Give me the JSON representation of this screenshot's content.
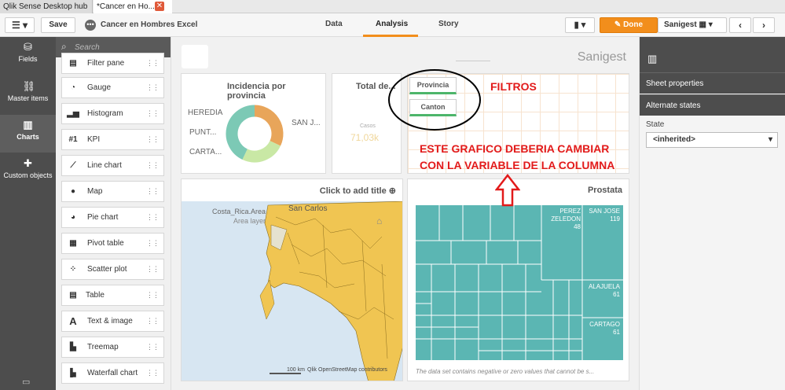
{
  "tabs": {
    "hub": "Qlik Sense Desktop hub",
    "app": "*Cancer en Ho..."
  },
  "toolbar": {
    "save": "Save",
    "app_name": "Cancer en Hombres Excel",
    "nav": [
      "Data",
      "Analysis",
      "Story"
    ],
    "done": "Done",
    "sheet_name": "Sanigest"
  },
  "left_rail": [
    "Fields",
    "Master items",
    "Charts",
    "Custom objects"
  ],
  "asset_panel": {
    "search_placeholder": "Search",
    "items": [
      "Filter pane",
      "Gauge",
      "Histogram",
      "KPI",
      "Line chart",
      "Map",
      "Pie chart",
      "Pivot table",
      "Scatter plot",
      "Table",
      "Text & image",
      "Treemap",
      "Waterfall chart"
    ]
  },
  "sheet": {
    "title": "Sanigest"
  },
  "donut": {
    "title": "Incidencia por provincia",
    "labels": [
      "HEREDIA",
      "PUNT...",
      "CARTA...",
      "SAN J..."
    ],
    "slices": [
      {
        "value": 32,
        "color": "#e8a55a"
      },
      {
        "value": 25,
        "color": "#c9e8a5"
      },
      {
        "value": 43,
        "color": "#7cc9b5"
      }
    ]
  },
  "kpi": {
    "title": "Total de...",
    "label": "Casos",
    "value": "71,03k"
  },
  "filters": [
    "Provincia",
    "Canton"
  ],
  "map": {
    "click_title": "Click to add title",
    "layer_name": "Costa_Rica.Area",
    "layer_type": "Area layer",
    "place": "San Carlos",
    "scale": "100 km",
    "attribution": "Qlik  OpenStreetMap contributors"
  },
  "treemap": {
    "title": "Prostata",
    "labels": [
      {
        "name": "PEREZ ZELEDON",
        "value": "48"
      },
      {
        "name": "SAN JOSE",
        "value": "119"
      },
      {
        "name": "ALAJUELA",
        "value": "61"
      },
      {
        "name": "CARTAGO",
        "value": "61"
      }
    ],
    "footnote": "The data set contains negative or zero values that cannot be s..."
  },
  "annotations": {
    "filtros": "FILTROS",
    "line1": "ESTE GRAFICO DEBERIA CAMBIAR",
    "line2": "CON LA VARIABLE DE LA COLUMNA"
  },
  "properties": {
    "sheet_properties": "Sheet properties",
    "alternate_states": "Alternate states",
    "state_label": "State",
    "state_value": "<inherited>"
  },
  "colors": {
    "accent": "#f28e1c",
    "teal": "#5bb6b3",
    "map_fill": "#f0c552",
    "annot": "#e21a1a"
  }
}
